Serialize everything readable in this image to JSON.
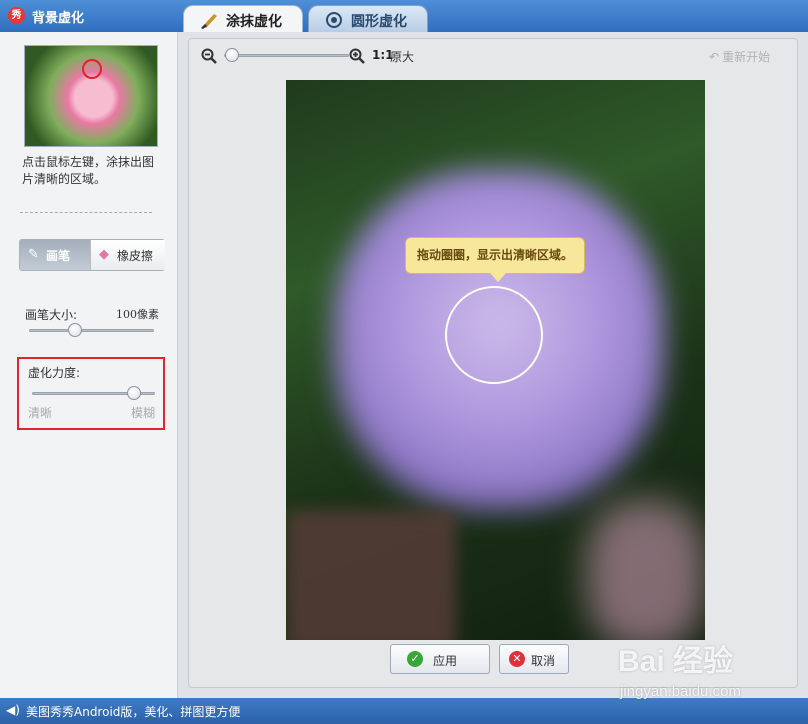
{
  "app": {
    "title": "背景虚化",
    "icon_text": "秀"
  },
  "tabs": [
    {
      "label": "涂抹虚化",
      "icon": "brush-icon",
      "active": true
    },
    {
      "label": "圆形虚化",
      "icon": "target-icon",
      "active": false
    }
  ],
  "left_panel": {
    "hint": "点击鼠标左键，涂抹出图片清晰的区域。",
    "tools": {
      "brush_label": "画笔",
      "eraser_label": "橡皮擦",
      "active": "brush"
    },
    "brush_size": {
      "label": "画笔大小:",
      "value": "100像素",
      "level": 0.35
    },
    "blur_strength": {
      "label": "虚化力度:",
      "min_label": "清晰",
      "max_label": "模糊",
      "level": 0.88
    }
  },
  "toolbar": {
    "zoom_ratio": "1:1",
    "original_size": "原大",
    "restart_label": "重新开始",
    "zoom_level": 0.0
  },
  "canvas": {
    "tooltip": "拖动圈圈，显示出清晰区域。"
  },
  "actions": {
    "apply_label": "应用",
    "cancel_label": "取消"
  },
  "status_bar": {
    "text": "美图秀秀Android版，美化、拼图更方便"
  },
  "watermark": {
    "text": "Bai 经验",
    "sub": "jingyan.baidu.com"
  },
  "colors": {
    "accent": "#2f6fbf",
    "highlight_box": "#e0262d",
    "tooltip_bg": "#f6e79b"
  }
}
